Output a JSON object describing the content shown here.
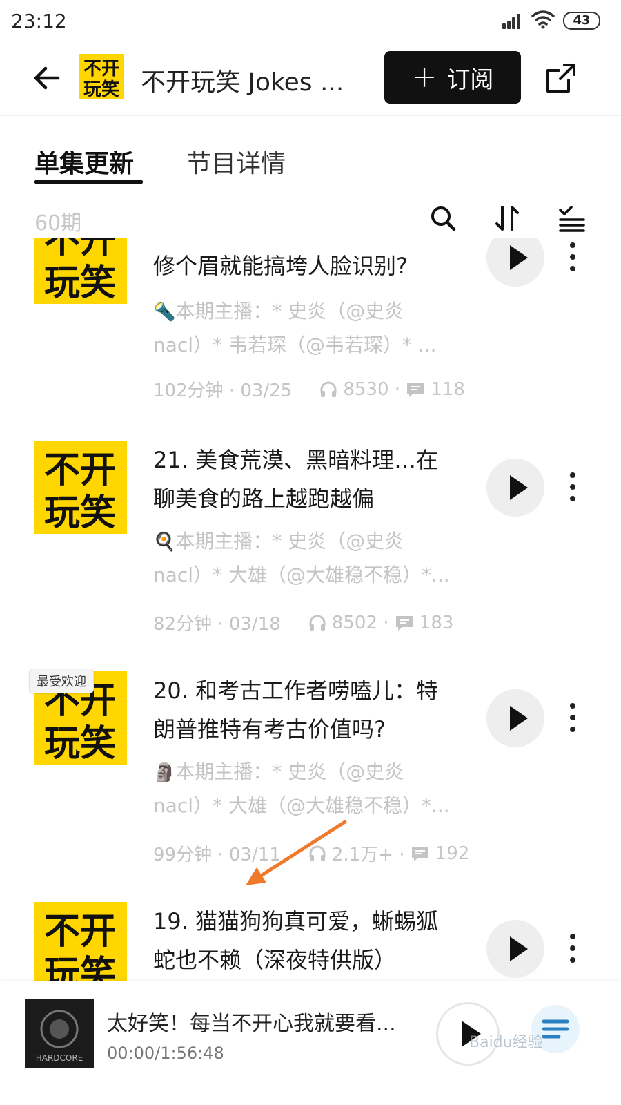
{
  "status_bar": {
    "time": "23:12",
    "battery": "43"
  },
  "header": {
    "title": "不开玩笑 Jokes ...",
    "subscribe_label": "订阅",
    "subscribe_plus": "+"
  },
  "tabs": [
    {
      "label": "单集更新",
      "active": true
    },
    {
      "label": "节目详情",
      "active": false
    }
  ],
  "toolbar": {
    "count": "60期"
  },
  "episodes": [
    {
      "title_lines": [
        "修个眉就能搞垮人脸识别?"
      ],
      "desc_line1": "本期主播：* 史炎（@史炎",
      "desc_line2": "nacl）* 韦若琛（@韦若琛）* ...",
      "emoji": "🔦",
      "duration_date": "102分钟 · 03/25",
      "plays": "8530 ·",
      "comments": "118"
    },
    {
      "title_lines": [
        "21. 美食荒漠、黑暗料理…在",
        "聊美食的路上越跑越偏"
      ],
      "desc_line1": "本期主播：* 史炎（@史炎",
      "desc_line2": "nacl）* 大雄（@大雄稳不稳）*...",
      "emoji": "🍳",
      "duration_date": "82分钟 · 03/18",
      "plays": "8502 ·",
      "comments": "183"
    },
    {
      "badge": "最受欢迎",
      "title_lines": [
        "20. 和考古工作者唠嗑儿：特",
        "朗普推特有考古价值吗?"
      ],
      "desc_line1": "本期主播：* 史炎（@史炎",
      "desc_line2": "nacl）* 大雄（@大雄稳不稳）*...",
      "emoji": "🗿",
      "duration_date": "99分钟 · 03/11",
      "plays": "2.1万+ ·",
      "comments": "192"
    },
    {
      "title_lines": [
        "19. 猫猫狗狗真可爱，蜥蜴狐",
        "蛇也不赖（深夜特供版）"
      ]
    }
  ],
  "cover_text": {
    "line1": "不开",
    "line2": "玩笑"
  },
  "player": {
    "title": "太好笑！每当不开心我就要看...",
    "time": "00:00/1:56:48",
    "cover_text": "HARDCORE"
  },
  "watermark": "Baidu经验",
  "colors": {
    "accent_yellow": "#ffd600",
    "primary": "#111111",
    "muted": "#c4c4c4",
    "arrow": "#f07a2c"
  },
  "icons": [
    "back-arrow-icon",
    "share-icon",
    "search-icon",
    "sort-icon",
    "multi-select-icon",
    "play-icon",
    "more-icon",
    "headphones-icon",
    "comment-icon",
    "playlist-icon"
  ]
}
